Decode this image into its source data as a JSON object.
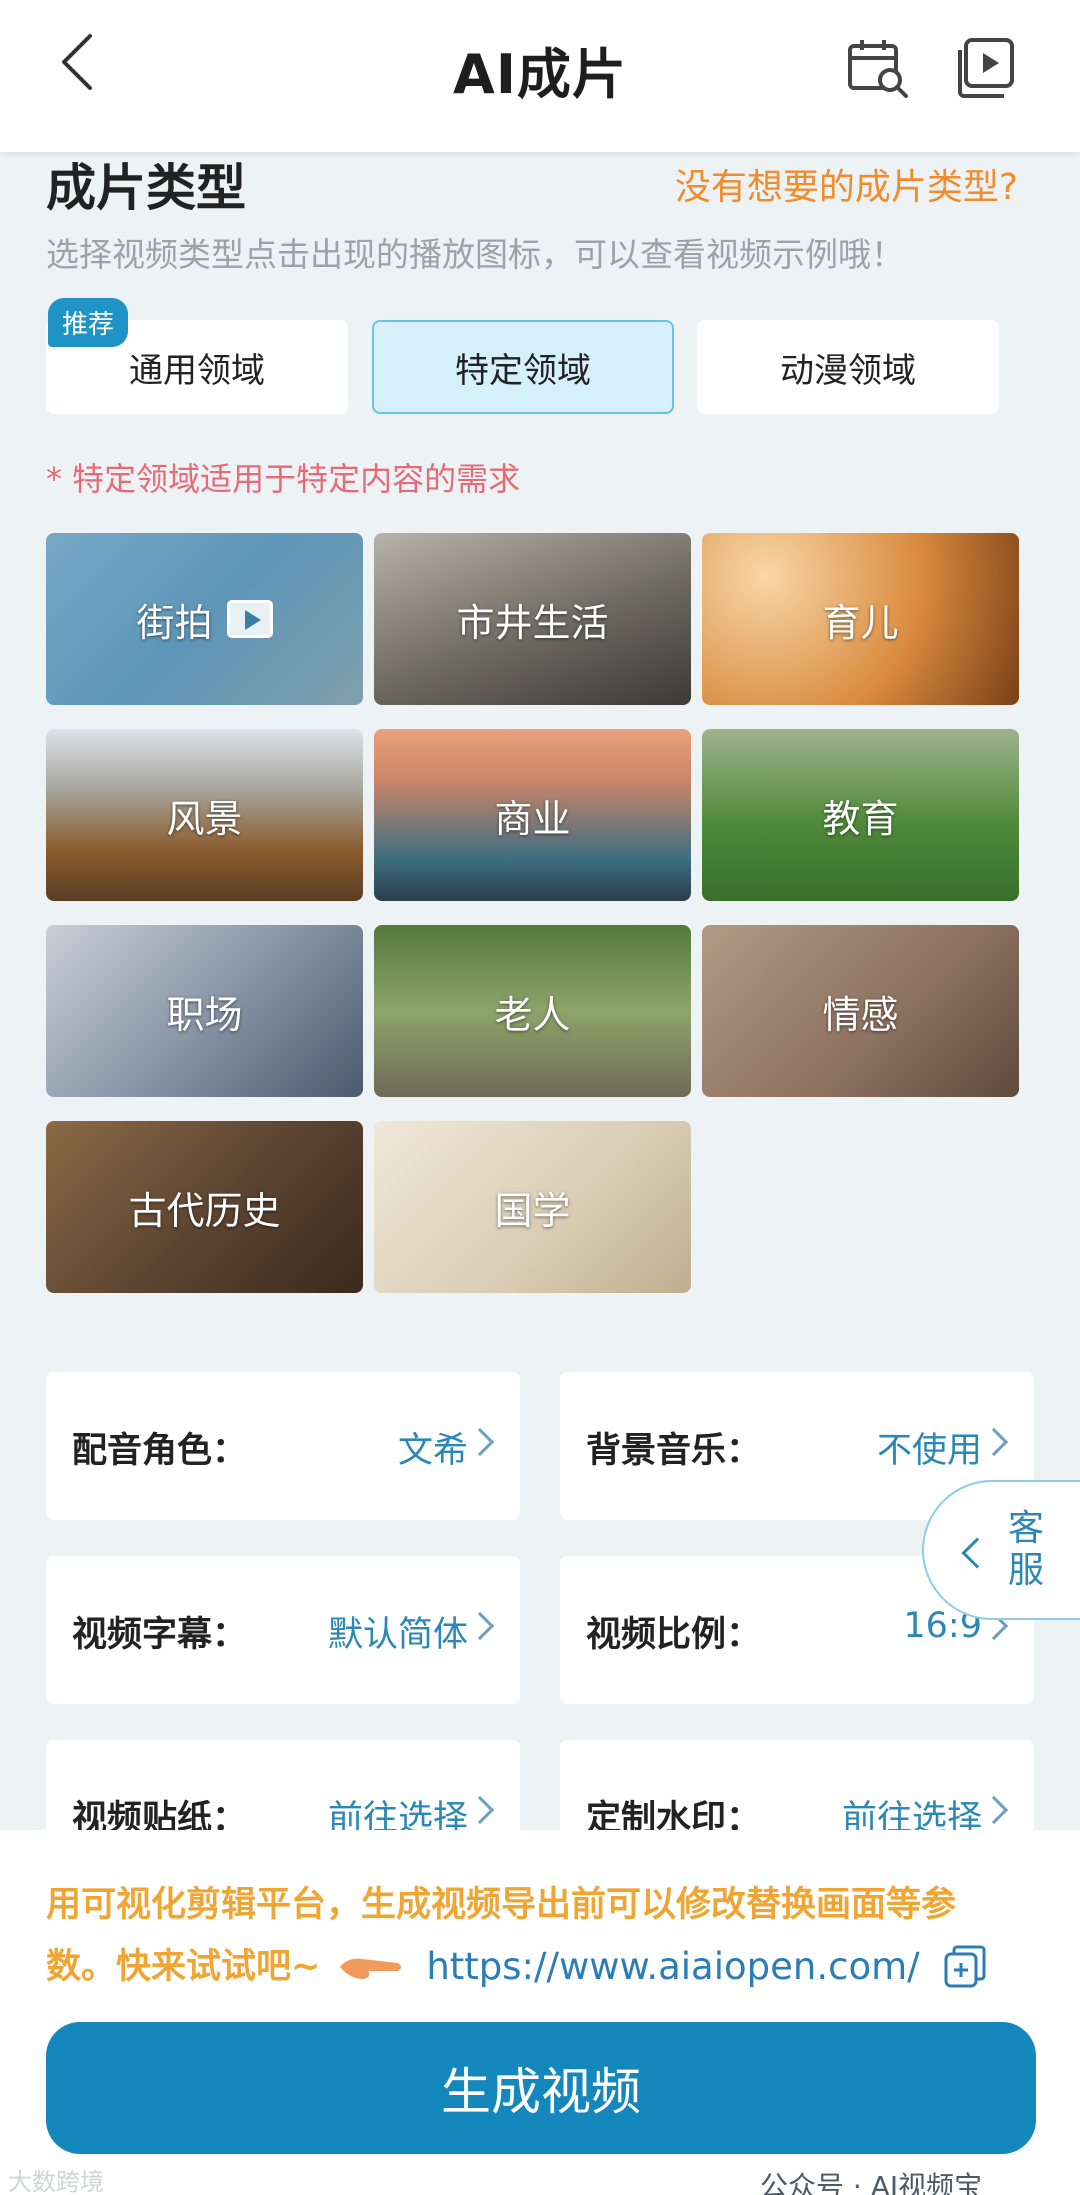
{
  "header": {
    "title": "AI成片",
    "icons": [
      "back-arrow",
      "calendar-search",
      "video-library"
    ]
  },
  "section": {
    "title": "成片类型",
    "link": "没有想要的成片类型?",
    "description": "选择视频类型点击出现的播放图标，可以查看视频示例哦！"
  },
  "tabs": {
    "badge": "推荐",
    "items": [
      "通用领域",
      "特定领域",
      "动漫领域"
    ],
    "active": "特定领域"
  },
  "note": "* 特定领域适用于特定内容的需求",
  "tiles": [
    "街拍",
    "市井生活",
    "育儿",
    "风景",
    "商业",
    "教育",
    "职场",
    "老人",
    "情感",
    "古代历史",
    "国学"
  ],
  "settings": [
    {
      "label": "配音角色：",
      "value": "文希"
    },
    {
      "label": "背景音乐：",
      "value": "不使用"
    },
    {
      "label": "视频字幕：",
      "value": "默认简体"
    },
    {
      "label": "视频比例：",
      "value": "16:9"
    },
    {
      "label": "视频贴纸：",
      "value": "前往选择"
    },
    {
      "label": "定制水印：",
      "value": "前往选择"
    }
  ],
  "service": "客服",
  "promo": {
    "line1": "用可视化剪辑平台，生成视频导出前可以修改替换画面等参",
    "line2": "数。快来试试吧~",
    "link": "https://www.aiaiopen.com/"
  },
  "generate_button": "生成视频",
  "watermark": "公众号 · AI视频宝",
  "watermark_left": "大数跨境",
  "colors": {
    "accent": "#1487bd",
    "orange": "#f08c2a",
    "pink_note": "#e56b78",
    "active_tab_bg": "#d6f0fb"
  }
}
